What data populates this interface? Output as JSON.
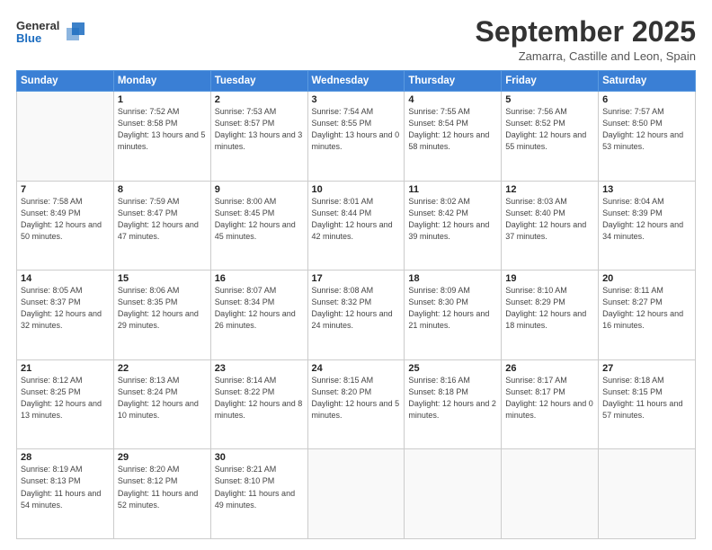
{
  "header": {
    "logo_general": "General",
    "logo_blue": "Blue",
    "month_title": "September 2025",
    "location": "Zamarra, Castille and Leon, Spain"
  },
  "days_of_week": [
    "Sunday",
    "Monday",
    "Tuesday",
    "Wednesday",
    "Thursday",
    "Friday",
    "Saturday"
  ],
  "weeks": [
    [
      {
        "day": null
      },
      {
        "day": 1,
        "sunrise": "7:52 AM",
        "sunset": "8:58 PM",
        "daylight": "13 hours and 5 minutes."
      },
      {
        "day": 2,
        "sunrise": "7:53 AM",
        "sunset": "8:57 PM",
        "daylight": "13 hours and 3 minutes."
      },
      {
        "day": 3,
        "sunrise": "7:54 AM",
        "sunset": "8:55 PM",
        "daylight": "13 hours and 0 minutes."
      },
      {
        "day": 4,
        "sunrise": "7:55 AM",
        "sunset": "8:54 PM",
        "daylight": "12 hours and 58 minutes."
      },
      {
        "day": 5,
        "sunrise": "7:56 AM",
        "sunset": "8:52 PM",
        "daylight": "12 hours and 55 minutes."
      },
      {
        "day": 6,
        "sunrise": "7:57 AM",
        "sunset": "8:50 PM",
        "daylight": "12 hours and 53 minutes."
      }
    ],
    [
      {
        "day": 7,
        "sunrise": "7:58 AM",
        "sunset": "8:49 PM",
        "daylight": "12 hours and 50 minutes."
      },
      {
        "day": 8,
        "sunrise": "7:59 AM",
        "sunset": "8:47 PM",
        "daylight": "12 hours and 47 minutes."
      },
      {
        "day": 9,
        "sunrise": "8:00 AM",
        "sunset": "8:45 PM",
        "daylight": "12 hours and 45 minutes."
      },
      {
        "day": 10,
        "sunrise": "8:01 AM",
        "sunset": "8:44 PM",
        "daylight": "12 hours and 42 minutes."
      },
      {
        "day": 11,
        "sunrise": "8:02 AM",
        "sunset": "8:42 PM",
        "daylight": "12 hours and 39 minutes."
      },
      {
        "day": 12,
        "sunrise": "8:03 AM",
        "sunset": "8:40 PM",
        "daylight": "12 hours and 37 minutes."
      },
      {
        "day": 13,
        "sunrise": "8:04 AM",
        "sunset": "8:39 PM",
        "daylight": "12 hours and 34 minutes."
      }
    ],
    [
      {
        "day": 14,
        "sunrise": "8:05 AM",
        "sunset": "8:37 PM",
        "daylight": "12 hours and 32 minutes."
      },
      {
        "day": 15,
        "sunrise": "8:06 AM",
        "sunset": "8:35 PM",
        "daylight": "12 hours and 29 minutes."
      },
      {
        "day": 16,
        "sunrise": "8:07 AM",
        "sunset": "8:34 PM",
        "daylight": "12 hours and 26 minutes."
      },
      {
        "day": 17,
        "sunrise": "8:08 AM",
        "sunset": "8:32 PM",
        "daylight": "12 hours and 24 minutes."
      },
      {
        "day": 18,
        "sunrise": "8:09 AM",
        "sunset": "8:30 PM",
        "daylight": "12 hours and 21 minutes."
      },
      {
        "day": 19,
        "sunrise": "8:10 AM",
        "sunset": "8:29 PM",
        "daylight": "12 hours and 18 minutes."
      },
      {
        "day": 20,
        "sunrise": "8:11 AM",
        "sunset": "8:27 PM",
        "daylight": "12 hours and 16 minutes."
      }
    ],
    [
      {
        "day": 21,
        "sunrise": "8:12 AM",
        "sunset": "8:25 PM",
        "daylight": "12 hours and 13 minutes."
      },
      {
        "day": 22,
        "sunrise": "8:13 AM",
        "sunset": "8:24 PM",
        "daylight": "12 hours and 10 minutes."
      },
      {
        "day": 23,
        "sunrise": "8:14 AM",
        "sunset": "8:22 PM",
        "daylight": "12 hours and 8 minutes."
      },
      {
        "day": 24,
        "sunrise": "8:15 AM",
        "sunset": "8:20 PM",
        "daylight": "12 hours and 5 minutes."
      },
      {
        "day": 25,
        "sunrise": "8:16 AM",
        "sunset": "8:18 PM",
        "daylight": "12 hours and 2 minutes."
      },
      {
        "day": 26,
        "sunrise": "8:17 AM",
        "sunset": "8:17 PM",
        "daylight": "12 hours and 0 minutes."
      },
      {
        "day": 27,
        "sunrise": "8:18 AM",
        "sunset": "8:15 PM",
        "daylight": "11 hours and 57 minutes."
      }
    ],
    [
      {
        "day": 28,
        "sunrise": "8:19 AM",
        "sunset": "8:13 PM",
        "daylight": "11 hours and 54 minutes."
      },
      {
        "day": 29,
        "sunrise": "8:20 AM",
        "sunset": "8:12 PM",
        "daylight": "11 hours and 52 minutes."
      },
      {
        "day": 30,
        "sunrise": "8:21 AM",
        "sunset": "8:10 PM",
        "daylight": "11 hours and 49 minutes."
      },
      {
        "day": null
      },
      {
        "day": null
      },
      {
        "day": null
      },
      {
        "day": null
      }
    ]
  ]
}
